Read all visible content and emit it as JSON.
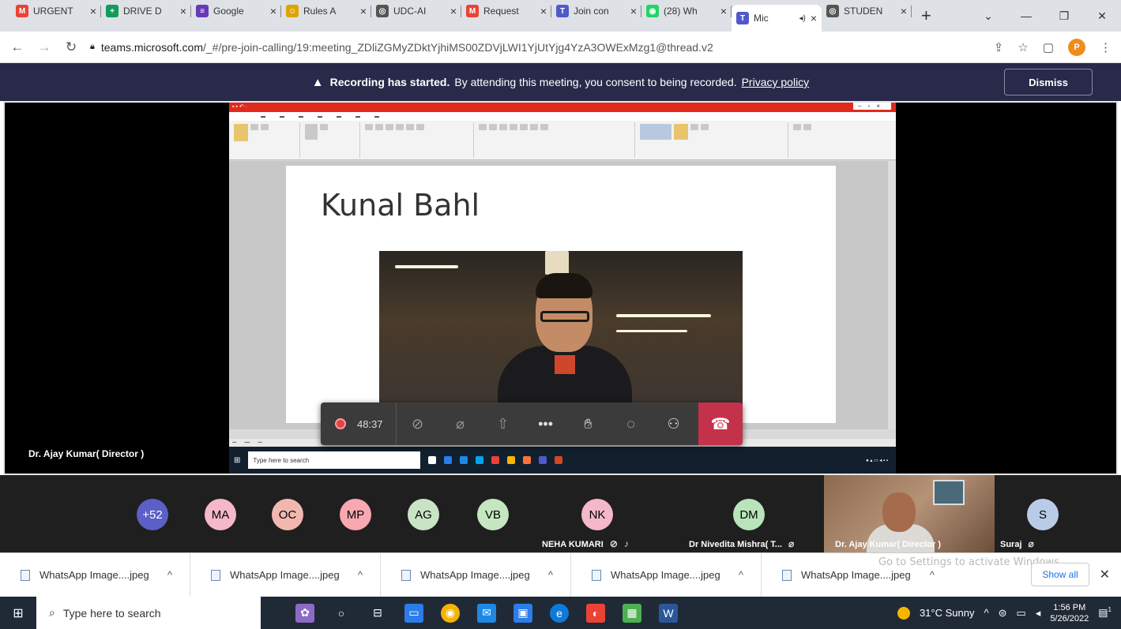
{
  "browser": {
    "tabs": [
      {
        "label": "URGENT",
        "icon": "gmail-icon",
        "color": "#ea4335",
        "glyph": "M"
      },
      {
        "label": "DRIVE D",
        "icon": "sheets-icon",
        "color": "#0f9d58",
        "glyph": "+"
      },
      {
        "label": "Google",
        "icon": "forms-icon",
        "color": "#673ab7",
        "glyph": "≡"
      },
      {
        "label": "Rules A",
        "icon": "emblem-icon",
        "color": "#e0a400",
        "glyph": "☺"
      },
      {
        "label": "UDC-AI",
        "icon": "globe-icon",
        "color": "#555555",
        "glyph": "◎"
      },
      {
        "label": "Request",
        "icon": "gmail-icon",
        "color": "#ea4335",
        "glyph": "M"
      },
      {
        "label": "Join con",
        "icon": "teams-icon",
        "color": "#5059c9",
        "glyph": "T"
      },
      {
        "label": "(28) Wh",
        "icon": "whatsapp-icon",
        "color": "#25d366",
        "glyph": "◉"
      },
      {
        "label": "Mic",
        "icon": "teams-icon",
        "color": "#5059c9",
        "glyph": "T",
        "active": true
      },
      {
        "label": "STUDEN",
        "icon": "globe-icon",
        "color": "#555555",
        "glyph": "◎"
      }
    ],
    "new_tab": "+",
    "url_domain": "teams.microsoft.com",
    "url_path": "/_#/pre-join-calling/19:meeting_ZDliZGMyZDktYjhiMS00ZDVjLWI1YjUtYjg4YzA3OWExMzg1@thread.v2",
    "profile_initial": "P"
  },
  "banner": {
    "bold": "Recording has started.",
    "text": "By attending this meeting, you consent to being recorded.",
    "link": "Privacy policy",
    "dismiss": "Dismiss"
  },
  "stage": {
    "presenter_name": "Dr. Ajay Kumar( Director )",
    "slide_title": "Kunal Bahl",
    "inner_search": "Type here to search"
  },
  "controls": {
    "timer": "48:37"
  },
  "participants": [
    {
      "initials": "+52",
      "color": "#5b5fc7",
      "text_color": "#ffffff"
    },
    {
      "initials": "MA",
      "color": "#f4b8c8"
    },
    {
      "initials": "OC",
      "color": "#f2b8b0"
    },
    {
      "initials": "MP",
      "color": "#f7a8b0"
    },
    {
      "initials": "AG",
      "color": "#c9e4c5"
    },
    {
      "initials": "VB",
      "color": "#c5e6c0"
    },
    {
      "initials": "NK",
      "color": "#f4b8c8",
      "name": "NEHA KUMARI"
    },
    {
      "initials": "DM",
      "color": "#b9e4bb",
      "name": "Dr Nivedita Mishra( T..."
    },
    {
      "initials": "",
      "name": "Dr. Ajay Kumar( Director )",
      "video": true
    },
    {
      "initials": "S",
      "color": "#b8cce8",
      "name": "Suraj"
    }
  ],
  "downloads": {
    "items": [
      "WhatsApp Image....jpeg",
      "WhatsApp Image....jpeg",
      "WhatsApp Image....jpeg",
      "WhatsApp Image....jpeg",
      "WhatsApp Image....jpeg"
    ],
    "show_all": "Show all",
    "activate_watermark": "Go to Settings to activate Windows."
  },
  "taskbar": {
    "search_placeholder": "Type here to search",
    "weather": "31°C  Sunny",
    "time": "1:56 PM",
    "date": "5/26/2022",
    "notifications": "1"
  }
}
